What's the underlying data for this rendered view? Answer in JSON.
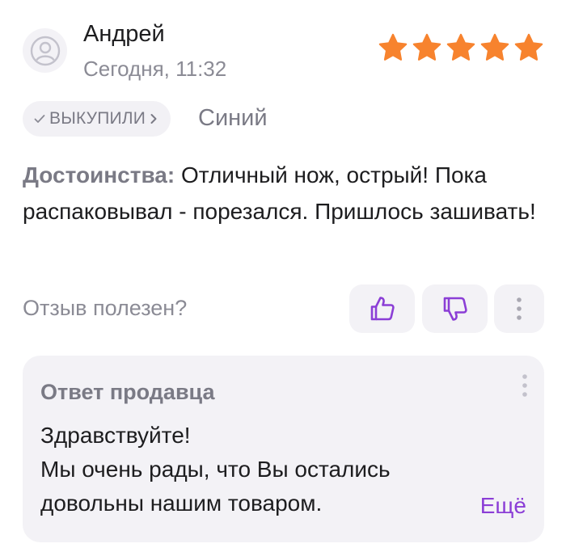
{
  "review": {
    "author": "Андрей",
    "date": "Сегодня, 11:32",
    "rating": 5,
    "rating_max": 5,
    "badge_label": "ВЫКУПИЛИ",
    "variant": "Синий",
    "pros_label": "Достоинства:",
    "pros_text": " Отличный нож, острый! Пока распаковывал - порезался. Пришлось зашивать!"
  },
  "feedback": {
    "question": "Отзыв полезен?"
  },
  "seller_reply": {
    "title": "Ответ продавца",
    "line1": "Здравствуйте!",
    "line2": "Мы очень рады, что Вы остались довольны нашим товаром.",
    "expand_label": "Ещё"
  },
  "colors": {
    "star": "#f7832e",
    "accent": "#8b3ed6",
    "muted": "#7a7a85",
    "surface": "#f3f2f6"
  },
  "icons": [
    "user-icon",
    "star-icon",
    "check-icon",
    "chevron-right-icon",
    "thumbs-up-icon",
    "thumbs-down-icon",
    "more-vertical-icon"
  ]
}
